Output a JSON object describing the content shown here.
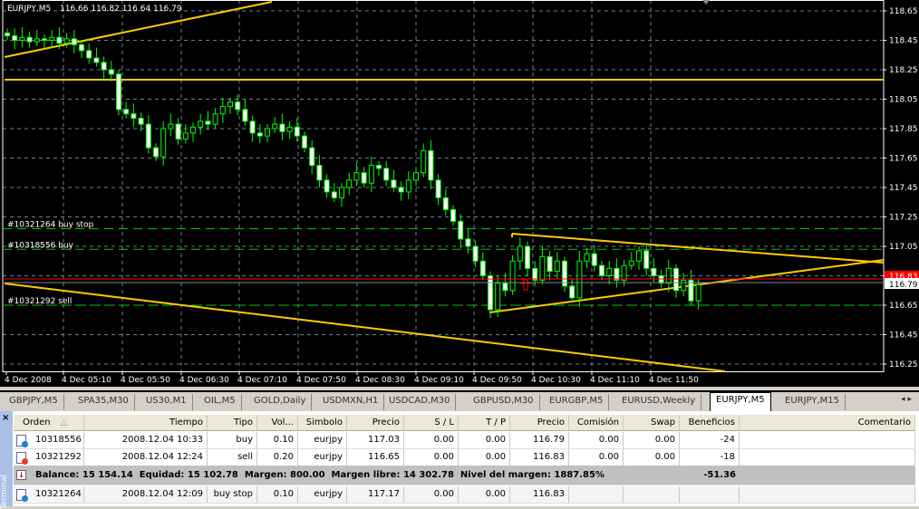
{
  "chart": {
    "title": "EURJPY,M5",
    "ohlc_readout": "116.66 116.82 116.64 116.79",
    "price_ticks": [
      "118.65",
      "118.45",
      "118.25",
      "118.05",
      "117.85",
      "117.65",
      "117.45",
      "117.25",
      "117.05",
      "116.85",
      "116.65",
      "116.45",
      "116.25"
    ],
    "time_labels": [
      "4 Dec 2008",
      "4 Dec 05:10",
      "4 Dec 05:50",
      "4 Dec 06:30",
      "4 Dec 07:10",
      "4 Dec 07:50",
      "4 Dec 08:30",
      "4 Dec 09:10",
      "4 Dec 09:50",
      "4 Dec 10:30",
      "4 Dec 11:10",
      "4 Dec 11:50"
    ],
    "bid_label": "116.83",
    "current_price": "116.79",
    "order_lines": [
      {
        "label": "#10321264 buy stop",
        "price": 117.17,
        "color": "#00c800"
      },
      {
        "label": "#10318556 buy",
        "price": 117.03,
        "color": "#00c800"
      },
      {
        "label": "#10321292 sell",
        "price": 116.65,
        "color": "#00c800"
      }
    ],
    "closes": [
      118.48,
      118.45,
      118.47,
      118.44,
      118.46,
      118.45,
      118.47,
      118.43,
      118.46,
      118.42,
      118.38,
      118.33,
      118.3,
      118.25,
      118.22,
      117.98,
      117.95,
      117.92,
      117.88,
      117.72,
      117.66,
      117.85,
      117.88,
      117.78,
      117.82,
      117.86,
      117.9,
      117.88,
      117.95,
      118.0,
      118.03,
      117.98,
      117.9,
      117.82,
      117.8,
      117.85,
      117.88,
      117.83,
      117.86,
      117.8,
      117.72,
      117.6,
      117.5,
      117.42,
      117.38,
      117.45,
      117.5,
      117.55,
      117.48,
      117.6,
      117.58,
      117.5,
      117.45,
      117.42,
      117.5,
      117.55,
      117.7,
      117.5,
      117.38,
      117.3,
      117.22,
      117.1,
      117.05,
      116.95,
      116.85,
      116.62,
      116.8,
      116.75,
      116.95,
      117.05,
      116.9,
      116.82,
      116.98,
      116.88,
      116.95,
      116.78,
      116.7,
      116.95,
      117.0,
      116.92,
      116.85,
      116.9,
      116.82,
      116.92,
      116.95,
      117.02,
      116.9,
      116.85,
      116.8,
      116.9,
      116.75,
      116.82,
      116.68,
      116.79
    ],
    "colors": {
      "background": "#000000",
      "grid": "#708090",
      "candle": "#00ff00",
      "trendline": "#ffcc00",
      "bid": "#ff0000"
    }
  },
  "tabs": [
    "GBPJPY,M5",
    "SPA35,M30",
    "US30,M1",
    "OIL,M5",
    "GOLD,Daily",
    "USDMXN,H1",
    "USDCAD,M30",
    "GBPUSD,M30",
    "EURGBP,M5",
    "EURUSD,Weekly",
    "EURJPY,M5",
    "EURJPY,M15"
  ],
  "active_tab": "EURJPY,M5",
  "terminal": {
    "side_label": "Terminal",
    "close": "×",
    "columns": [
      "Orden",
      "Tiempo",
      "Tipo",
      "Vol...",
      "Simbolo",
      "Precio",
      "S / L",
      "T / P",
      "Precio",
      "Comisión",
      "Swap",
      "Beneficios",
      "Comentario"
    ],
    "sort_indicator": "△",
    "rows": [
      {
        "status": "buy",
        "cells": [
          "10318556",
          "2008.12.04 10:33",
          "buy",
          "0.10",
          "eurjpy",
          "117.03",
          "0.00",
          "0.00",
          "116.79",
          "0.00",
          "0.00",
          "-24",
          ""
        ]
      },
      {
        "status": "sell",
        "cells": [
          "10321292",
          "2008.12.04 12:24",
          "sell",
          "0.20",
          "eurjpy",
          "116.65",
          "0.00",
          "0.00",
          "116.83",
          "0.00",
          "0.00",
          "-18",
          ""
        ]
      }
    ],
    "balance_line": "Balance: 15 154.14  Equidad: 15 102.78  Margen: 800.00  Margen libre: 14 302.78  Nivel del margen: 1887.85%",
    "balance_total": "-51.36",
    "pending": [
      {
        "status": "buy",
        "cells": [
          "10321264",
          "2008.12.04 12:09",
          "buy stop",
          "0.10",
          "eurjpy",
          "117.17",
          "0.00",
          "0.00",
          "116.83",
          "",
          "",
          "",
          ""
        ]
      }
    ]
  }
}
